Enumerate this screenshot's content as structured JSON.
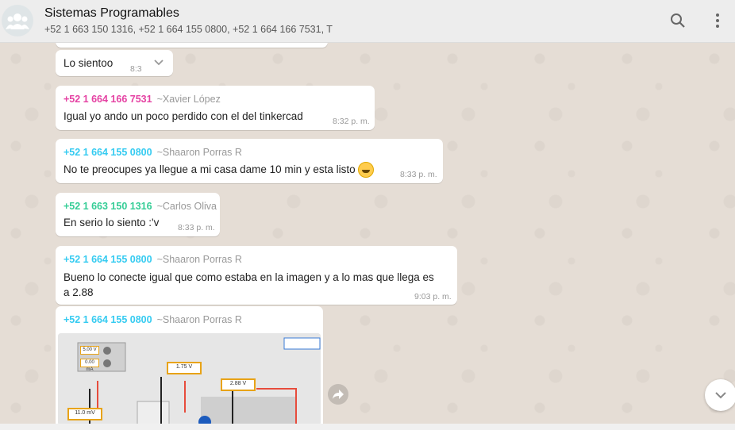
{
  "header": {
    "title": "Sistemas Programables",
    "subtitle": "+52 1 663 150 1316, +52 1 664 155 0800, +52 1 664 166 7531, T"
  },
  "messages": [
    {
      "text": "Lo sientoo",
      "time": "8:3"
    },
    {
      "sender_number": "+52 1 664 166 7531",
      "sender_name": "~Xavier López",
      "text": "Igual yo ando un poco perdido con el del tinkercad",
      "time": "8:32 p. m."
    },
    {
      "sender_number": "+52 1 664 155 0800",
      "sender_name": "~Shaaron Porras R",
      "text": "No te preocupes ya llegue a mi casa dame 10 min y esta listo",
      "emoji": "grinning-sweat-emoji",
      "time": "8:33 p. m."
    },
    {
      "sender_number": "+52 1 663 150 1316",
      "sender_name": "~Carlos Oliva",
      "text": "En serio lo siento :'v",
      "time": "8:33 p. m."
    },
    {
      "sender_number": "+52 1 664 155 0800",
      "sender_name": "~Shaaron Porras R",
      "text_line1": "Bueno lo conecte igual que como estaba en la imagen y a lo mas que llega es",
      "text_line2": "a 2.88",
      "time": "9:03 p. m."
    },
    {
      "sender_number": "+52 1 664 155 0800",
      "sender_name": "~Shaaron Porras R",
      "image_meters": [
        "1.75 V",
        "2.88 V",
        "11.0 mV",
        "5.00 V",
        "0.00 mA"
      ]
    }
  ],
  "icons": {
    "avatar": "group-avatar-icon",
    "search": "search-icon",
    "menu": "more-vert-icon",
    "dropdown": "chevron-down-icon",
    "forward": "forward-icon",
    "scroll": "chevron-down-icon"
  },
  "colors": {
    "pink": "#e542a3",
    "blue": "#35cbf1",
    "green": "#35cd96"
  }
}
